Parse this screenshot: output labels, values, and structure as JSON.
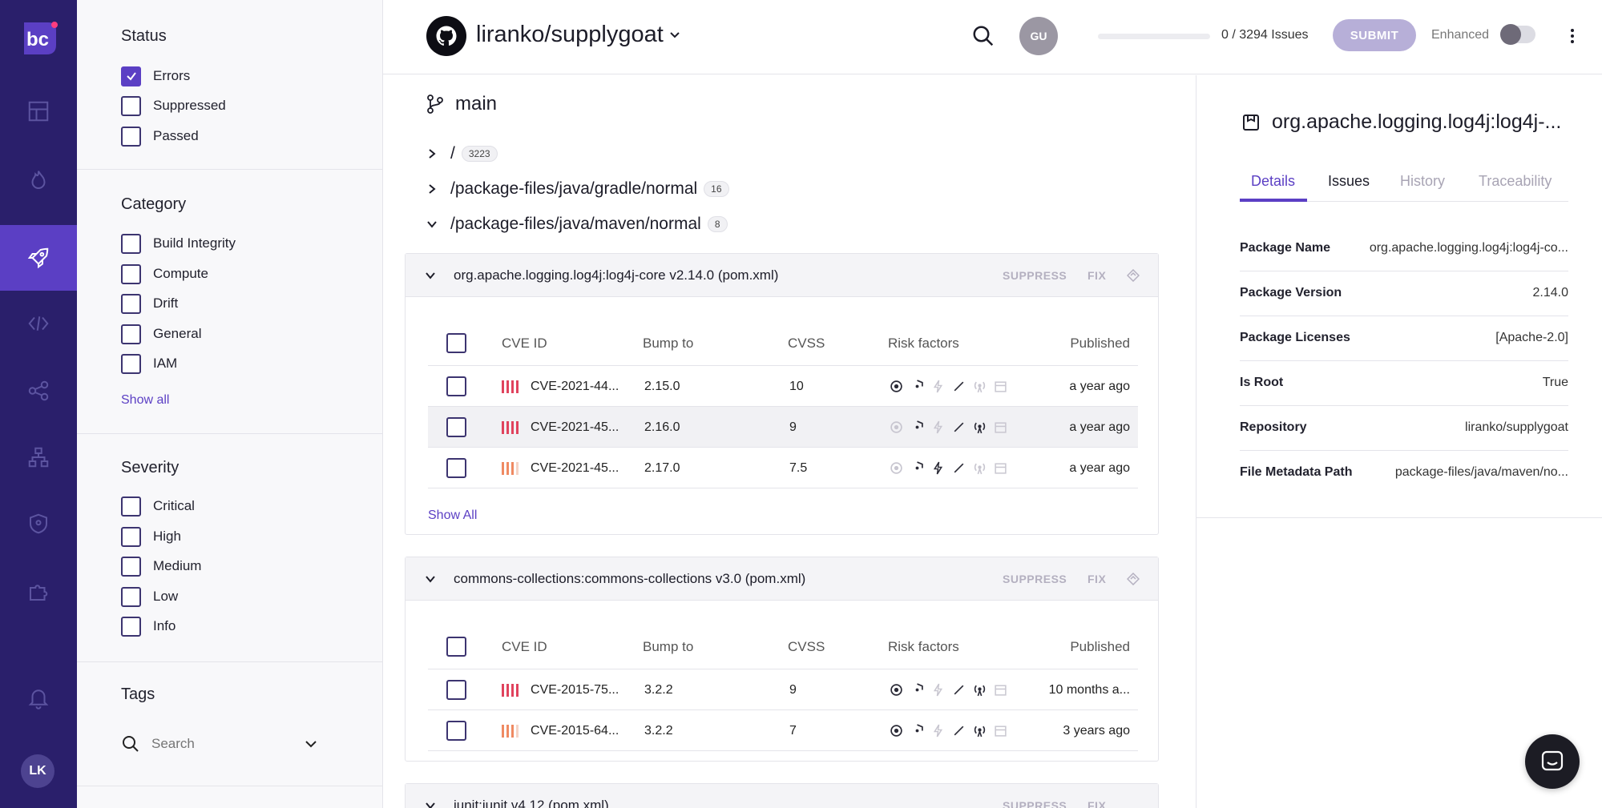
{
  "colors": {
    "accent": "#5b3fc4",
    "rail": "#2a1f6b",
    "critical": "#e0435d",
    "high": "#ef8a62"
  },
  "rail": {
    "logo_text": "bc",
    "items": [
      {
        "icon": "dashboard-icon"
      },
      {
        "icon": "flame-icon"
      },
      {
        "icon": "rocket-icon",
        "active": true
      },
      {
        "icon": "code-icon"
      },
      {
        "icon": "share-nodes-icon"
      },
      {
        "icon": "hierarchy-icon"
      },
      {
        "icon": "shield-icon"
      },
      {
        "icon": "puzzle-icon"
      },
      {
        "icon": "bell-icon"
      }
    ],
    "avatar": "LK"
  },
  "filters": {
    "status": {
      "title": "Status",
      "options": [
        {
          "label": "Errors",
          "checked": true
        },
        {
          "label": "Suppressed",
          "checked": false
        },
        {
          "label": "Passed",
          "checked": false
        }
      ]
    },
    "category": {
      "title": "Category",
      "options": [
        {
          "label": "Build Integrity"
        },
        {
          "label": "Compute"
        },
        {
          "label": "Drift"
        },
        {
          "label": "General"
        },
        {
          "label": "IAM"
        }
      ],
      "show_all": "Show all"
    },
    "severity": {
      "title": "Severity",
      "options": [
        {
          "label": "Critical"
        },
        {
          "label": "High"
        },
        {
          "label": "Medium"
        },
        {
          "label": "Low"
        },
        {
          "label": "Info"
        }
      ]
    },
    "tags": {
      "title": "Tags",
      "search_placeholder": "Search"
    }
  },
  "header": {
    "repo": "liranko/supplygoat",
    "user_initials": "GU",
    "progress": 0,
    "issues_count": "0 / 3294 Issues",
    "submit_label": "SUBMIT",
    "enhanced_label": "Enhanced"
  },
  "main": {
    "branch": "main",
    "tree": [
      {
        "path": "/",
        "count": "3223",
        "expanded": false
      },
      {
        "path": "/package-files/java/gradle/normal",
        "count": "16",
        "expanded": false
      },
      {
        "path": "/package-files/java/maven/normal",
        "count": "8",
        "expanded": true
      }
    ],
    "columns": {
      "cve": "CVE ID",
      "bump": "Bump to",
      "cvss": "CVSS",
      "risk": "Risk factors",
      "published": "Published"
    },
    "suppress_label": "SUPPRESS",
    "fix_label": "FIX",
    "show_all_label": "Show All",
    "packages": [
      {
        "title": "org.apache.logging.log4j:log4j-core v2.14.0 (pom.xml)",
        "rows": [
          {
            "cve": "CVE-2021-44...",
            "bump": "2.15.0",
            "cvss": "10",
            "published": "a year ago",
            "severity": "critical"
          },
          {
            "cve": "CVE-2021-45...",
            "bump": "2.16.0",
            "cvss": "9",
            "published": "a year ago",
            "severity": "critical"
          },
          {
            "cve": "CVE-2021-45...",
            "bump": "2.17.0",
            "cvss": "7.5",
            "published": "a year ago",
            "severity": "high"
          }
        ]
      },
      {
        "title": "commons-collections:commons-collections v3.0 (pom.xml)",
        "rows": [
          {
            "cve": "CVE-2015-75...",
            "bump": "3.2.2",
            "cvss": "9",
            "published": "10 months a...",
            "severity": "critical"
          },
          {
            "cve": "CVE-2015-64...",
            "bump": "3.2.2",
            "cvss": "7",
            "published": "3 years ago",
            "severity": "high"
          }
        ]
      },
      {
        "title": "junit:junit v4.12 (pom.xml)",
        "rows": []
      }
    ]
  },
  "details": {
    "title": "org.apache.logging.log4j:log4j-...",
    "tabs": [
      "Details",
      "Issues",
      "History",
      "Traceability"
    ],
    "props": [
      {
        "key": "Package Name",
        "value": "org.apache.logging.log4j:log4j-co..."
      },
      {
        "key": "Package Version",
        "value": "2.14.0"
      },
      {
        "key": "Package Licenses",
        "value": "[Apache-2.0]"
      },
      {
        "key": "Is Root",
        "value": "True"
      },
      {
        "key": "Repository",
        "value": "liranko/supplygoat"
      },
      {
        "key": "File Metadata Path",
        "value": "package-files/java/maven/no..."
      }
    ]
  }
}
